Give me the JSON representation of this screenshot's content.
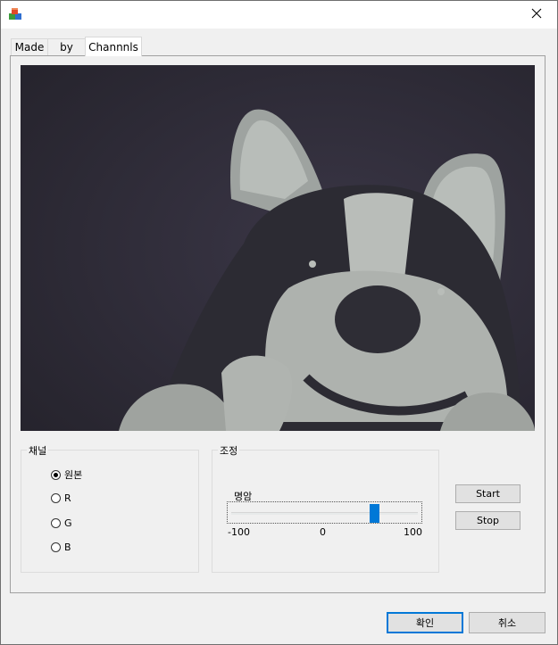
{
  "tabs": [
    "Made",
    "by",
    "Channnls"
  ],
  "channel": {
    "title": "채널",
    "options": [
      "원본",
      "R",
      "G",
      "B"
    ],
    "selected_index": 0
  },
  "adjust": {
    "title": "조정",
    "slider_label": "명암",
    "min_label": "-100",
    "mid_label": "0",
    "max_label": "100",
    "min": -100,
    "max": 100,
    "value": 55
  },
  "buttons": {
    "start": "Start",
    "stop": "Stop",
    "ok": "확인",
    "cancel": "취소"
  },
  "colors": {
    "accent": "#0078d7",
    "preview_bg": "#2f2c38"
  },
  "icons": {
    "app": "app-icon",
    "close": "close-icon"
  }
}
